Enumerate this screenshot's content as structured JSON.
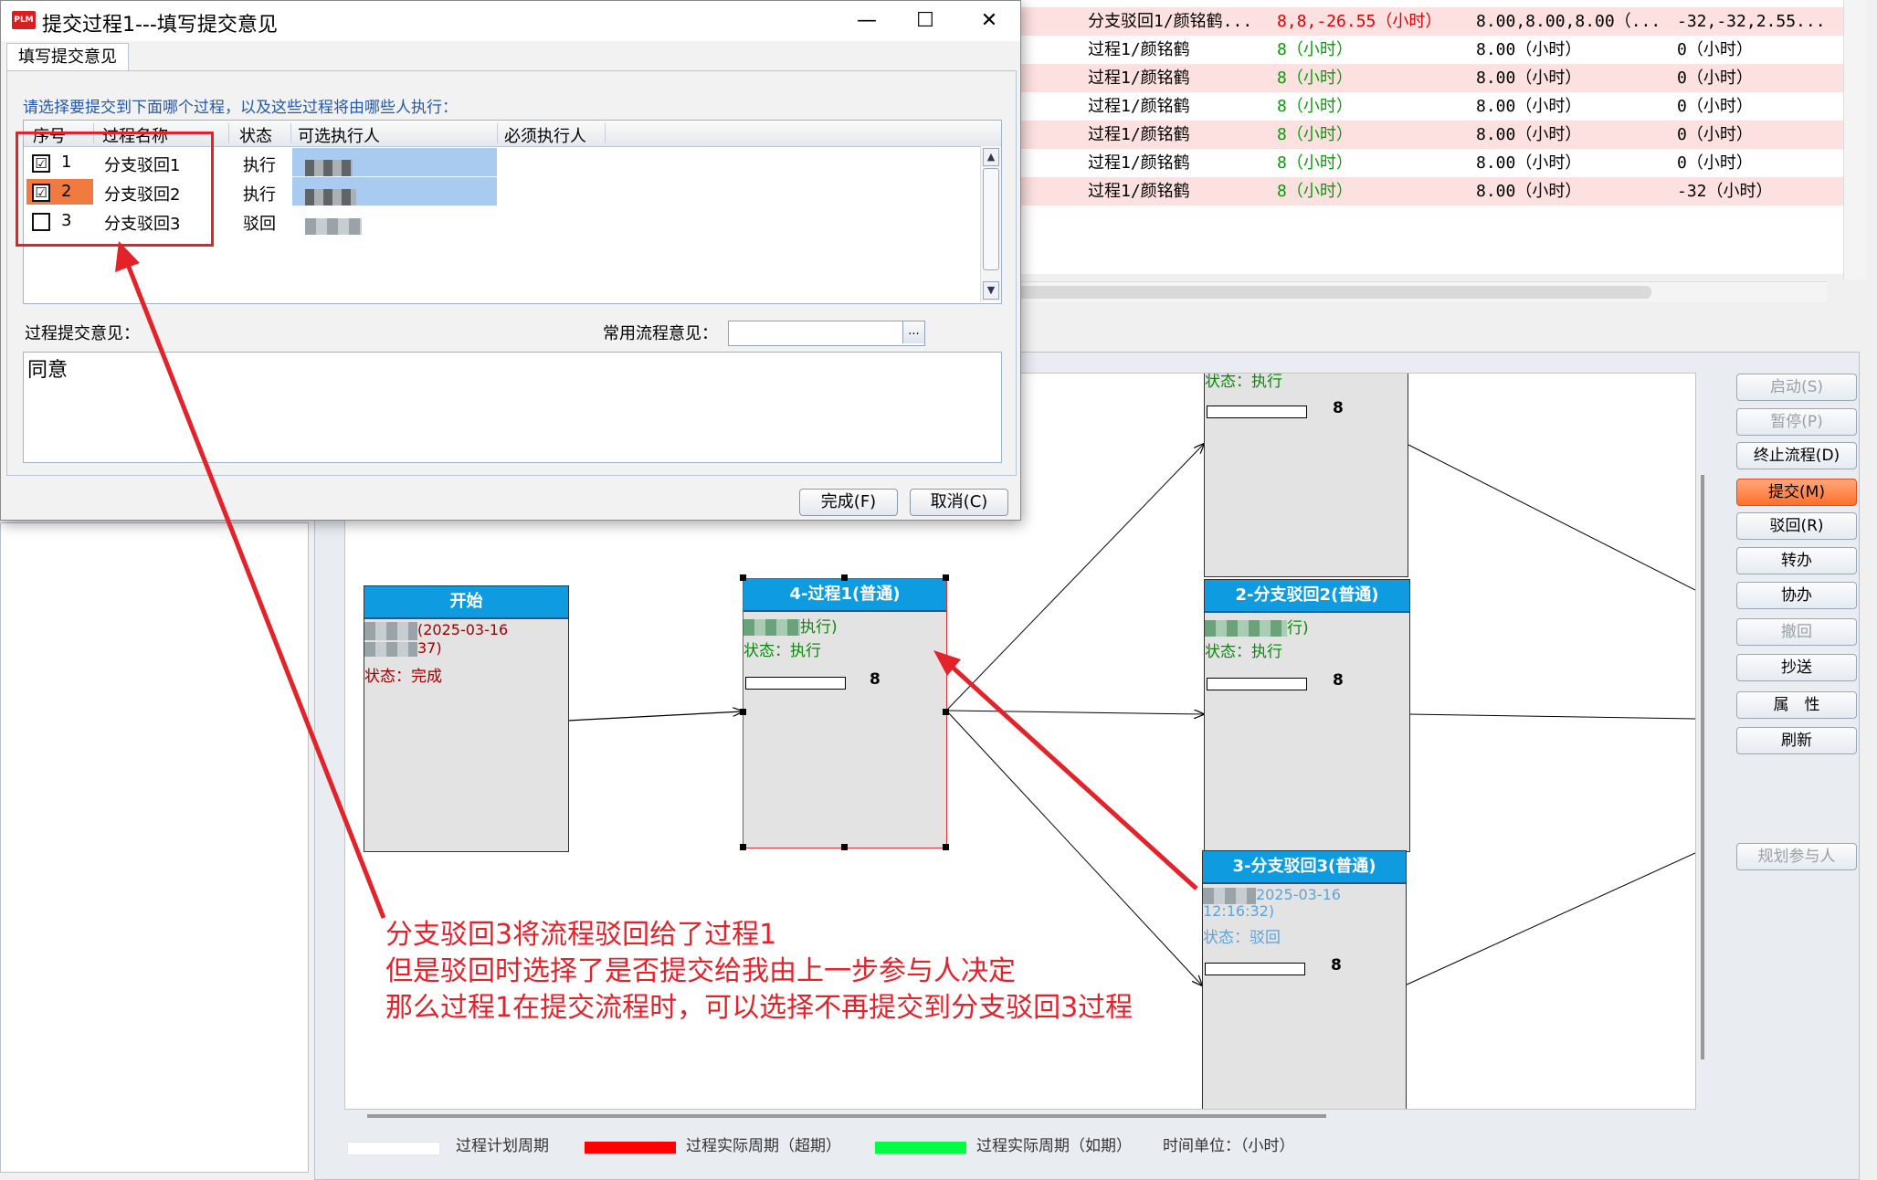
{
  "dialog": {
    "title": "提交过程1---填写提交意见",
    "app_icon_text": "PLM",
    "tab": "填写提交意见",
    "prompt": "请选择要提交到下面哪个过程，以及这些过程将由哪些人执行：",
    "columns": [
      "序号",
      "过程名称",
      "状态",
      "可选执行人",
      "必须执行人"
    ],
    "rows": [
      {
        "checked": "☑",
        "num": "1",
        "name": "分支驳回1",
        "status": "执行"
      },
      {
        "checked": "☑",
        "num": "2",
        "name": "分支驳回2",
        "status": "执行"
      },
      {
        "checked": "",
        "num": "3",
        "name": "分支驳回3",
        "status": "驳回"
      }
    ],
    "opinion_label": "过程提交意见：",
    "common_label": "常用流程意见：",
    "combo_button": "...",
    "opinion_text": "同意",
    "finish_button": "完成(F)",
    "cancel_button": "取消(C)",
    "minimize": "—",
    "maximize": "☐",
    "close": "✕"
  },
  "grid_rows": [
    {
      "pink": true,
      "c1": "分支驳回1/颜铭鹤...",
      "c2": "8,8,-26.55（小时）",
      "c3": "8.00,8.00,8.00（...",
      "c4": "-32,-32,2.55...",
      "c2red": true
    },
    {
      "pink": false,
      "c1": "过程1/颜铭鹤",
      "c2": "8（小时）",
      "c3": "8.00（小时）",
      "c4": "0（小时）"
    },
    {
      "pink": true,
      "c1": "过程1/颜铭鹤",
      "c2": "8（小时）",
      "c3": "8.00（小时）",
      "c4": "0（小时）"
    },
    {
      "pink": false,
      "c1": "过程1/颜铭鹤",
      "c2": "8（小时）",
      "c3": "8.00（小时）",
      "c4": "0（小时）"
    },
    {
      "pink": true,
      "c1": "过程1/颜铭鹤",
      "c2": "8（小时）",
      "c3": "8.00（小时）",
      "c4": "0（小时）"
    },
    {
      "pink": false,
      "c1": "过程1/颜铭鹤",
      "c2": "8（小时）",
      "c3": "8.00（小时）",
      "c4": "0（小时）"
    },
    {
      "pink": true,
      "c1": "过程1/颜铭鹤",
      "c2": "8（小时）",
      "c3": "8.00（小时）",
      "c4": "-32（小时）"
    }
  ],
  "side_buttons": [
    {
      "label": "启动(S)",
      "disabled": true
    },
    {
      "label": "暂停(P)",
      "disabled": true
    },
    {
      "label": "终止流程(D)",
      "disabled": false
    },
    {
      "label": "提交(M)",
      "primary": true
    },
    {
      "label": "驳回(R)",
      "disabled": false
    },
    {
      "label": "转办",
      "disabled": false
    },
    {
      "label": "协办",
      "disabled": false
    },
    {
      "label": "撤回",
      "disabled": true
    },
    {
      "label": "抄送",
      "disabled": false
    },
    {
      "label": "属　性",
      "disabled": false
    },
    {
      "label": "刷新",
      "disabled": false
    },
    {
      "label": "规划参与人",
      "disabled": true
    }
  ],
  "nodes": {
    "start": {
      "title": "开始",
      "date": "(2025-03-16",
      "time": "37)",
      "status": "状态：完成"
    },
    "process1": {
      "title": "4-过程1(普通)",
      "role": "执行)",
      "status": "状态：执行",
      "num": "8"
    },
    "top": {
      "status": "状态：执行",
      "num": "8"
    },
    "branch2": {
      "title": "2-分支驳回2(普通)",
      "role": "行)",
      "status": "状态：执行",
      "num": "8"
    },
    "branch3": {
      "title": "3-分支驳回3(普通)",
      "date": "2025-03-16",
      "time": "12:16:32)",
      "status": "状态：驳回",
      "num": "8"
    }
  },
  "legend": {
    "planned": "过程计划周期",
    "overdue": "过程实际周期（超期）",
    "ontime": "过程实际周期（如期）",
    "unit": "时间单位：（小时）"
  },
  "annotation": {
    "line1": "分支驳回3将流程驳回给了过程1",
    "line2": "但是驳回时选择了是否提交给我由上一步参与人决定",
    "line3": "那么过程1在提交流程时，可以选择不再提交到分支驳回3过程"
  },
  "colors": {
    "accent": "#0f9be0",
    "annotation": "#e4222a",
    "overdue": "#ff0000",
    "ontime": "#00ff44",
    "primary_button": "#ff6f2c"
  }
}
